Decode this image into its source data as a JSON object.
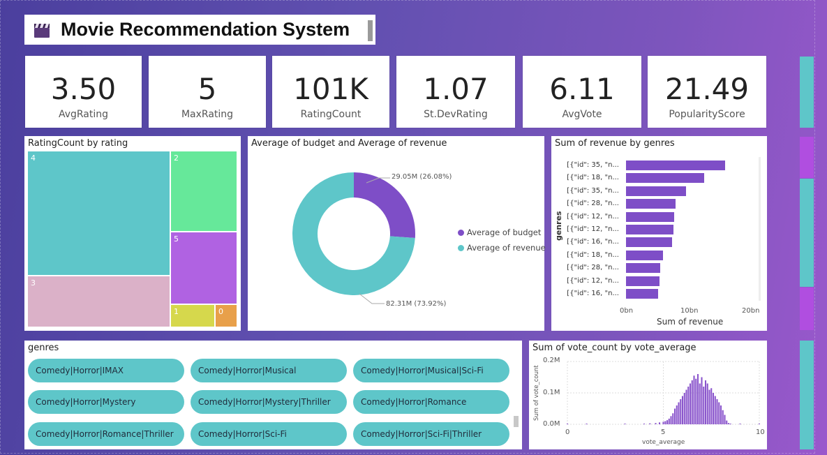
{
  "header": {
    "title": "Movie Recommendation System",
    "icon": "clapperboard-icon"
  },
  "kpis": [
    {
      "value": "3.50",
      "label": "AvgRating"
    },
    {
      "value": "5",
      "label": "MaxRating"
    },
    {
      "value": "101K",
      "label": "RatingCount"
    },
    {
      "value": "1.07",
      "label": "St.DevRating"
    },
    {
      "value": "6.11",
      "label": "AvgVote"
    },
    {
      "value": "21.49",
      "label": "PopularityScore"
    }
  ],
  "treemap": {
    "title": "RatingCount by rating",
    "cells": [
      {
        "label": "4",
        "color": "#5ec6c9"
      },
      {
        "label": "2",
        "color": "#66e89a"
      },
      {
        "label": "5",
        "color": "#b062e2"
      },
      {
        "label": "3",
        "color": "#dbb1c8"
      },
      {
        "label": "1",
        "color": "#d6d84c"
      },
      {
        "label": "0",
        "color": "#e8a04a"
      }
    ]
  },
  "donut": {
    "title": "Average of budget and Average of revenue",
    "slices": [
      {
        "name": "Average of budget",
        "value": 29.05,
        "label": "29.05M (26.08%)",
        "color": "#7e4ec7"
      },
      {
        "name": "Average of revenue",
        "value": 82.31,
        "label": "82.31M (73.92%)",
        "color": "#5ec6c9"
      }
    ]
  },
  "revenue": {
    "title": "Sum of revenue by genres",
    "ylabel": "genres",
    "xlabel": "Sum of revenue",
    "ticks": [
      "0bn",
      "10bn",
      "20bn"
    ],
    "max": 20,
    "rows": [
      {
        "label": "[{\"id\": 35, \"n...",
        "value": 16.2
      },
      {
        "label": "[{\"id\": 18, \"n...",
        "value": 12.8
      },
      {
        "label": "[{\"id\": 35, \"n...",
        "value": 9.8
      },
      {
        "label": "[{\"id\": 28, \"n...",
        "value": 8.1
      },
      {
        "label": "[{\"id\": 12, \"n...",
        "value": 7.9
      },
      {
        "label": "[{\"id\": 12, \"n...",
        "value": 7.8
      },
      {
        "label": "[{\"id\": 16, \"n...",
        "value": 7.5
      },
      {
        "label": "[{\"id\": 18, \"n...",
        "value": 6.0
      },
      {
        "label": "[{\"id\": 28, \"n...",
        "value": 5.6
      },
      {
        "label": "[{\"id\": 12, \"n...",
        "value": 5.5
      },
      {
        "label": "[{\"id\": 16, \"n...",
        "value": 5.3
      }
    ]
  },
  "genres": {
    "title": "genres",
    "items": [
      "Comedy|Horror|IMAX",
      "Comedy|Horror|Musical",
      "Comedy|Horror|Musical|Sci-Fi",
      "Comedy|Horror|Mystery",
      "Comedy|Horror|Mystery|Thriller",
      "Comedy|Horror|Romance",
      "Comedy|Horror|Romance|Thriller",
      "Comedy|Horror|Sci-Fi",
      "Comedy|Horror|Sci-Fi|Thriller"
    ]
  },
  "chart_data": {
    "type": "bar",
    "title": "Sum of vote_count by vote_average",
    "xlabel": "vote_average",
    "ylabel": "Sum of vote_count",
    "xlim": [
      0,
      10
    ],
    "ylim": [
      0,
      0.2
    ],
    "xticks": [
      "0",
      "5",
      "10"
    ],
    "yticks": [
      "0.0M",
      "0.1M",
      "0.2M"
    ],
    "x": [
      0.0,
      0.5,
      1.0,
      1.5,
      2.0,
      3.0,
      4.0,
      4.3,
      4.6,
      4.8,
      5.0,
      5.1,
      5.2,
      5.3,
      5.4,
      5.5,
      5.6,
      5.7,
      5.8,
      5.9,
      6.0,
      6.1,
      6.2,
      6.3,
      6.4,
      6.5,
      6.6,
      6.7,
      6.8,
      6.9,
      7.0,
      7.1,
      7.2,
      7.3,
      7.4,
      7.5,
      7.6,
      7.7,
      7.8,
      7.9,
      8.0,
      8.1,
      8.2,
      8.3,
      8.4,
      8.5,
      9.0,
      10.0
    ],
    "values": [
      0.001,
      0.0,
      0.001,
      0.0,
      0.0,
      0.001,
      0.002,
      0.003,
      0.004,
      0.006,
      0.008,
      0.01,
      0.013,
      0.018,
      0.026,
      0.035,
      0.05,
      0.06,
      0.07,
      0.08,
      0.09,
      0.1,
      0.11,
      0.12,
      0.13,
      0.14,
      0.155,
      0.145,
      0.16,
      0.13,
      0.15,
      0.12,
      0.14,
      0.13,
      0.11,
      0.115,
      0.1,
      0.09,
      0.08,
      0.07,
      0.06,
      0.045,
      0.03,
      0.012,
      0.004,
      0.002,
      0.001,
      0.001
    ]
  },
  "side_tabs": [
    {
      "color": "#5ec6c9"
    },
    {
      "color": "#b04ee0"
    },
    {
      "color": "#5ec6c9"
    },
    {
      "color": "#b04ee0"
    },
    {
      "color": "#5ec6c9"
    }
  ]
}
